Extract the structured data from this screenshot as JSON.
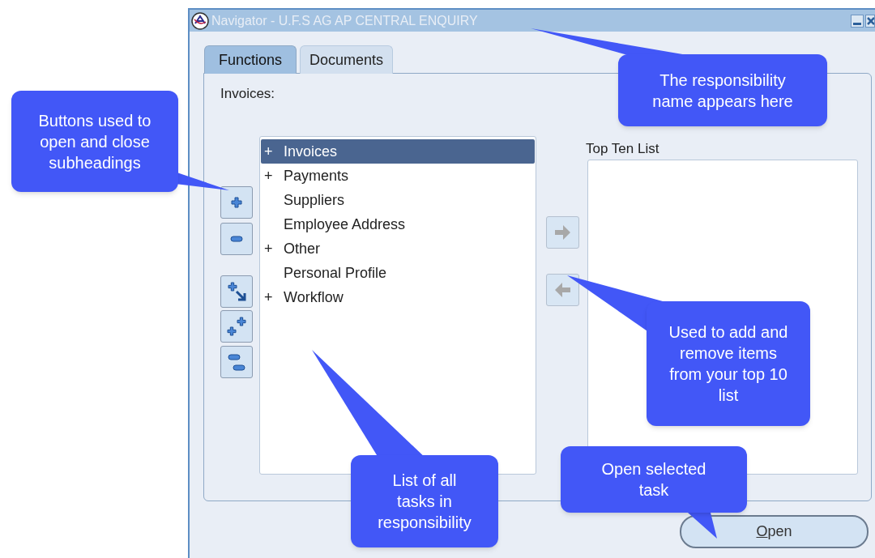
{
  "window": {
    "title": "Navigator - U.F.S AG AP CENTRAL ENQUIRY"
  },
  "tabs": [
    {
      "label": "Functions",
      "selected": true
    },
    {
      "label": "Documents",
      "selected": false
    }
  ],
  "section_label": "Invoices:",
  "tree": [
    {
      "toggle": "+",
      "label": "Invoices",
      "selected": true
    },
    {
      "toggle": "+",
      "label": "Payments",
      "selected": false
    },
    {
      "label": "Suppliers",
      "selected": false
    },
    {
      "label": "Employee Address",
      "selected": false
    },
    {
      "toggle": "+",
      "label": "Other",
      "selected": false
    },
    {
      "label": "Personal Profile",
      "selected": false
    },
    {
      "toggle": "+",
      "label": "Workflow",
      "selected": false
    }
  ],
  "tree_buttons": [
    {
      "kind": "expand"
    },
    {
      "kind": "collapse"
    },
    {
      "kind": "expand_branch"
    },
    {
      "kind": "expand_all"
    },
    {
      "kind": "collapse_all"
    }
  ],
  "transfer_buttons": [
    {
      "kind": "add",
      "disabled": true
    },
    {
      "kind": "remove",
      "disabled": true
    }
  ],
  "top_ten": {
    "label": "Top Ten List"
  },
  "open_button": {
    "label": "Open"
  },
  "callouts": [
    {
      "text": "Buttons used to open and close subheadings"
    },
    {
      "text": "The responsibility name appears here"
    },
    {
      "text": "Used to add and remove items from your top 10 list"
    },
    {
      "text": "List of all tasks in responsibility"
    },
    {
      "text": "Open selected task"
    }
  ]
}
